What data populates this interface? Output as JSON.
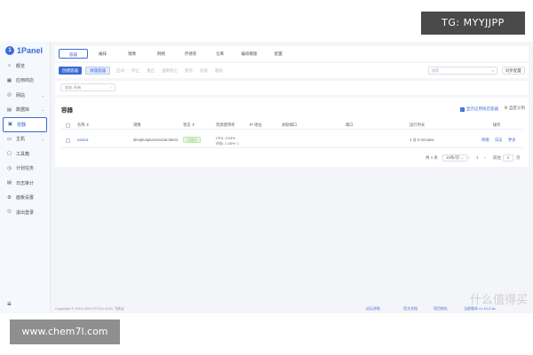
{
  "watermarks": {
    "top": "TG: MYYJJPP",
    "bottom": "www.chem7l.com",
    "brand": "什么值得买"
  },
  "sidebar": {
    "logo": "1Panel",
    "logo_mark": "1",
    "items": [
      {
        "label": "概览",
        "icon": "home-icon",
        "glyph": "⌂",
        "chevron": ""
      },
      {
        "label": "应用商店",
        "icon": "grid-icon",
        "glyph": "▦",
        "chevron": ""
      },
      {
        "label": "网站",
        "icon": "globe-icon",
        "glyph": "◎",
        "chevron": "⌄"
      },
      {
        "label": "数据库",
        "icon": "database-icon",
        "glyph": "▤",
        "chevron": "⌄"
      },
      {
        "label": "容器",
        "icon": "container-icon",
        "glyph": "▣",
        "chevron": ""
      },
      {
        "label": "主机",
        "icon": "host-icon",
        "glyph": "▭",
        "chevron": "⌄"
      },
      {
        "label": "工具箱",
        "icon": "toolbox-icon",
        "glyph": "▢",
        "chevron": ""
      },
      {
        "label": "计划任务",
        "icon": "schedule-icon",
        "glyph": "◷",
        "chevron": ""
      },
      {
        "label": "日志审计",
        "icon": "log-icon",
        "glyph": "▤",
        "chevron": ""
      },
      {
        "label": "面板设置",
        "icon": "settings-icon",
        "glyph": "⚙",
        "chevron": ""
      },
      {
        "label": "退出登录",
        "icon": "logout-icon",
        "glyph": "⎋",
        "chevron": ""
      }
    ],
    "active_index": 4,
    "collapse_glyph": "≡"
  },
  "tabs": [
    "容器",
    "编排",
    "镜像",
    "网络",
    "存储卷",
    "仓库",
    "编排模版",
    "配置"
  ],
  "toolbar": {
    "create_label": "创建容器",
    "cleanup_label": "清理容器",
    "actions": [
      "启动",
      "停止",
      "重启",
      "强制停止",
      "暂停",
      "恢复",
      "删除"
    ],
    "search_placeholder": "搜索",
    "search_glyph": "⌕",
    "sync_label": "同步配置"
  },
  "filter": {
    "value": "状态: 所有",
    "chevron": "⌄"
  },
  "table": {
    "title": "容器",
    "show_app_label": "显示应用商店容器",
    "show_app_checked": true,
    "check_glyph": "✓",
    "columns_label": "⊕ 自定义列",
    "headers": [
      "名称 ⇕",
      "镜像",
      "状态 ⇕",
      "资源使用率",
      "IP 地址",
      "关联端口",
      "端口",
      "运行时长",
      "操作"
    ],
    "rows": [
      {
        "name": "navica",
        "image": "alexplusplus/navicat:latest",
        "status": "已运行",
        "cpu": "CPU: 0.04%",
        "mem": "内存: 1.45% ⓘ",
        "ip": "",
        "ports_rel": "",
        "ports": "",
        "uptime": "1 分 5 minutes",
        "actions": [
          "终端",
          "日志",
          "更多"
        ]
      }
    ]
  },
  "pagination": {
    "total": "共 1 条",
    "page_size": "10条/页 ⌄",
    "prev": "‹",
    "page": "1",
    "next": "›",
    "goto_label": "前往",
    "goto_value": "1",
    "page_unit": "页"
  },
  "footer": {
    "copyright": "Copyright © 2014-2024 FIT2CLOUD 飞致云",
    "links": [
      "论坛求助",
      "官方文档",
      "项目地址",
      "当前版本 v1.10.2-lts"
    ]
  },
  "colors": {
    "accent": "#3b6ad8",
    "running": "#67c23a"
  }
}
